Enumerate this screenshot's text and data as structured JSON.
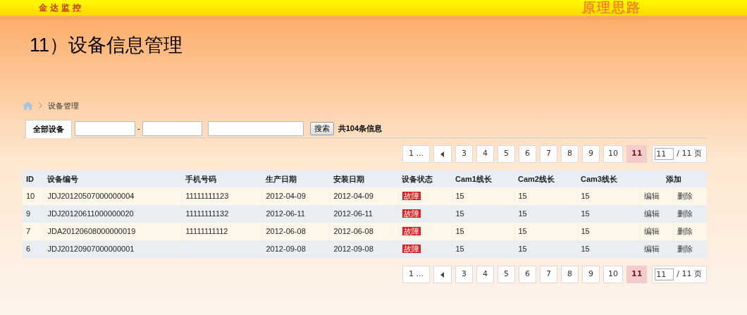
{
  "header": {
    "brand": "金达监控",
    "section": "原理思路"
  },
  "slide_title": "11）设备信息管理",
  "breadcrumb": {
    "items": [
      "设备管理"
    ]
  },
  "toolbar": {
    "tabs": [
      {
        "label": "全部设备",
        "selected": true
      }
    ],
    "range_separator": "-",
    "search_button": "搜索",
    "count_prefix": "共",
    "count": "104",
    "count_suffix": "条信息"
  },
  "pagination_top": {
    "first": "1 ...",
    "pages": [
      {
        "label": "3",
        "selected": false
      },
      {
        "label": "4",
        "selected": false
      },
      {
        "label": "5",
        "selected": false
      },
      {
        "label": "6",
        "selected": false
      },
      {
        "label": "7",
        "selected": false
      },
      {
        "label": "8",
        "selected": false
      },
      {
        "label": "9",
        "selected": false
      },
      {
        "label": "10",
        "selected": false
      },
      {
        "label": "11",
        "selected": true
      }
    ],
    "page_input": "11",
    "total": "/ 11 页"
  },
  "table": {
    "columns": [
      "ID",
      "设备编号",
      "手机号码",
      "生产日期",
      "安装日期",
      "设备状态",
      "Cam1线长",
      "Cam2线长",
      "Cam3线长",
      "添加"
    ],
    "rows": [
      {
        "cells": [
          "10",
          "JDJ20120507000000004",
          "11111111123",
          "2012-04-09",
          "2012-04-09"
        ],
        "status": "故障",
        "cams": [
          "15",
          "15",
          "15"
        ],
        "actions": [
          "编辑",
          "删除"
        ]
      },
      {
        "cells": [
          "9",
          "JDJ20120611000000020",
          "11111111132",
          "2012-06-11",
          "2012-06-11"
        ],
        "status": "故障",
        "cams": [
          "15",
          "15",
          "15"
        ],
        "actions": [
          "编辑",
          "删除"
        ]
      },
      {
        "cells": [
          "7",
          "JDA20120608000000019",
          "11111111112",
          "2012-06-08",
          "2012-06-08"
        ],
        "status": "故障",
        "cams": [
          "15",
          "15",
          "15"
        ],
        "actions": [
          "编辑",
          "删除"
        ]
      },
      {
        "cells": [
          "6",
          "JDJ20120907000000001",
          "",
          "2012-09-08",
          "2012-09-08"
        ],
        "status": "故障",
        "cams": [
          "15",
          "15",
          "15"
        ],
        "actions": [
          "编辑",
          "删除"
        ]
      }
    ]
  },
  "pagination_bottom": {
    "first": "1 ...",
    "pages": [
      {
        "label": "3",
        "selected": false
      },
      {
        "label": "4",
        "selected": false
      },
      {
        "label": "5",
        "selected": false
      },
      {
        "label": "6",
        "selected": false
      },
      {
        "label": "7",
        "selected": false
      },
      {
        "label": "8",
        "selected": false
      },
      {
        "label": "9",
        "selected": false
      },
      {
        "label": "10",
        "selected": false
      },
      {
        "label": "11",
        "selected": true
      }
    ],
    "page_input": "11",
    "total": "/ 11 页"
  }
}
